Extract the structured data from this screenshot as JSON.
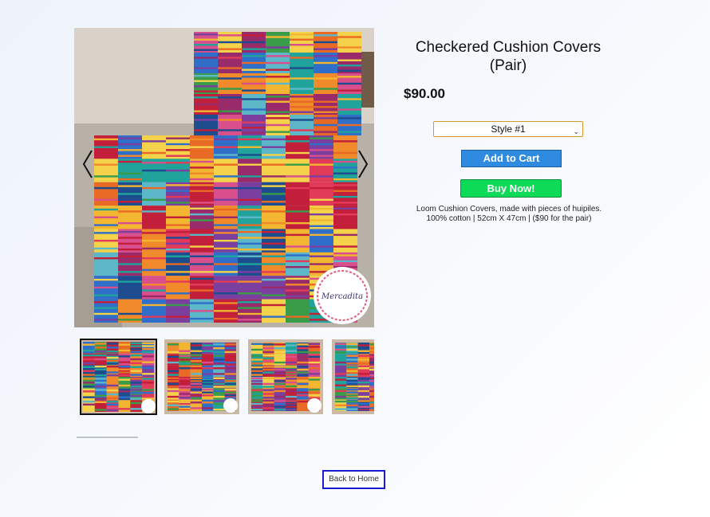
{
  "product": {
    "title_line1": "Checkered Cushion Covers",
    "title_line2": "(Pair)",
    "price": "$90.00",
    "style_selected": "Style #1",
    "add_to_cart_label": "Add to Cart",
    "buy_now_label": "Buy Now!",
    "description_line1": "Loom Cushion Covers, made with pieces of huipiles.",
    "description_line2": "100% cotton | 52cm X 47cm | ($90 for the pair)"
  },
  "gallery": {
    "prev_icon": "chevron-left-icon",
    "next_icon": "chevron-right-icon",
    "selected_index": 0,
    "thumbnail_count": 4,
    "logo_text": "Mercadita"
  },
  "navigation": {
    "back_label": "Back to Home"
  },
  "colors": {
    "add_to_cart": "#2f8be0",
    "buy_now": "#0ddb57",
    "select_border": "#d29a2a",
    "back_border": "#1a1acf"
  }
}
